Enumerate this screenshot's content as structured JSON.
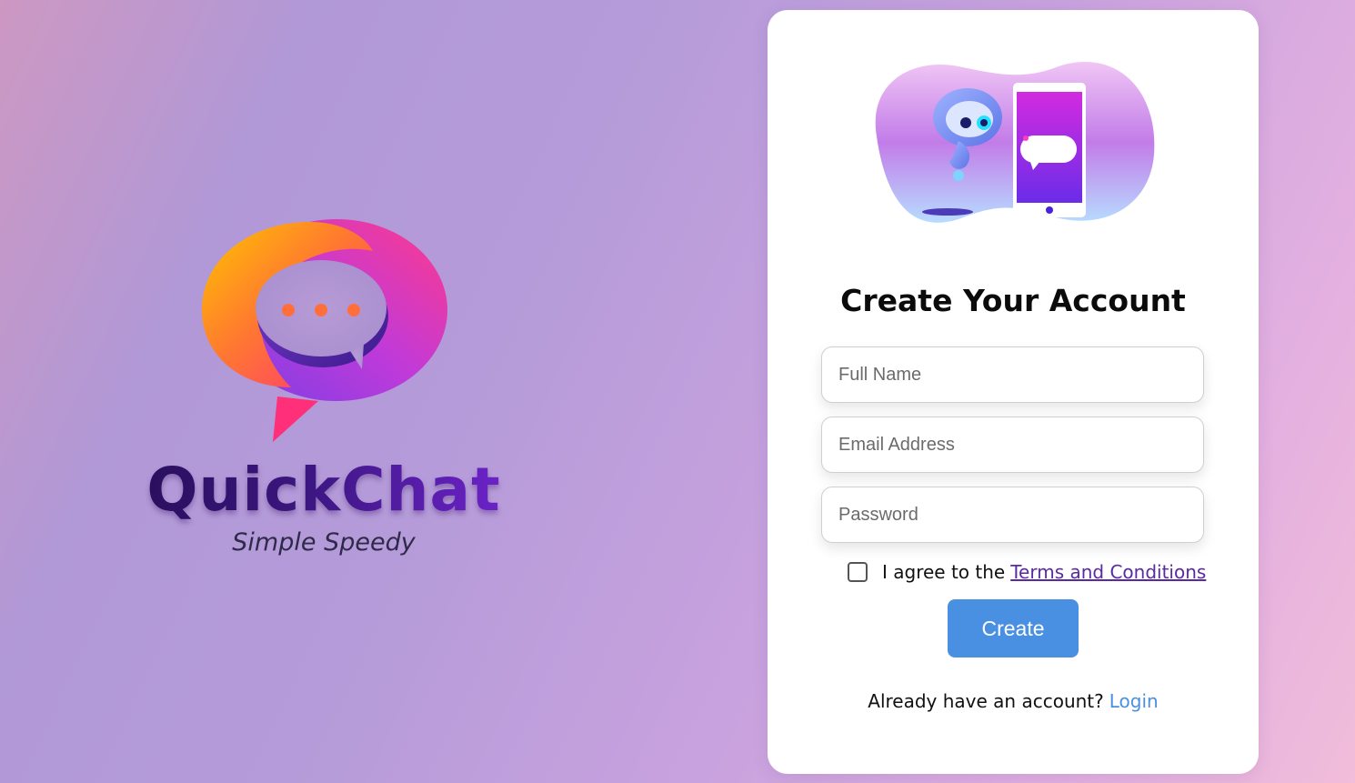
{
  "brand": {
    "name": "QuickChat",
    "tagline": "Simple Speedy"
  },
  "form": {
    "title": "Create Your Account",
    "full_name_placeholder": "Full Name",
    "email_placeholder": "Email Address",
    "password_placeholder": "Password",
    "agree_prefix": "I agree to the",
    "terms_link": "Terms and Conditions",
    "agree_checked": false,
    "create_label": "Create",
    "login_prompt": "Already have an account?",
    "login_link": "Login"
  },
  "colors": {
    "primary_button": "#4a90e2",
    "terms_link": "#5a2aa0",
    "login_link": "#4a90e2"
  },
  "icons": {
    "logo": "speech-bubble-logo-icon",
    "illustration": "robot-phone-chat-illustration"
  }
}
